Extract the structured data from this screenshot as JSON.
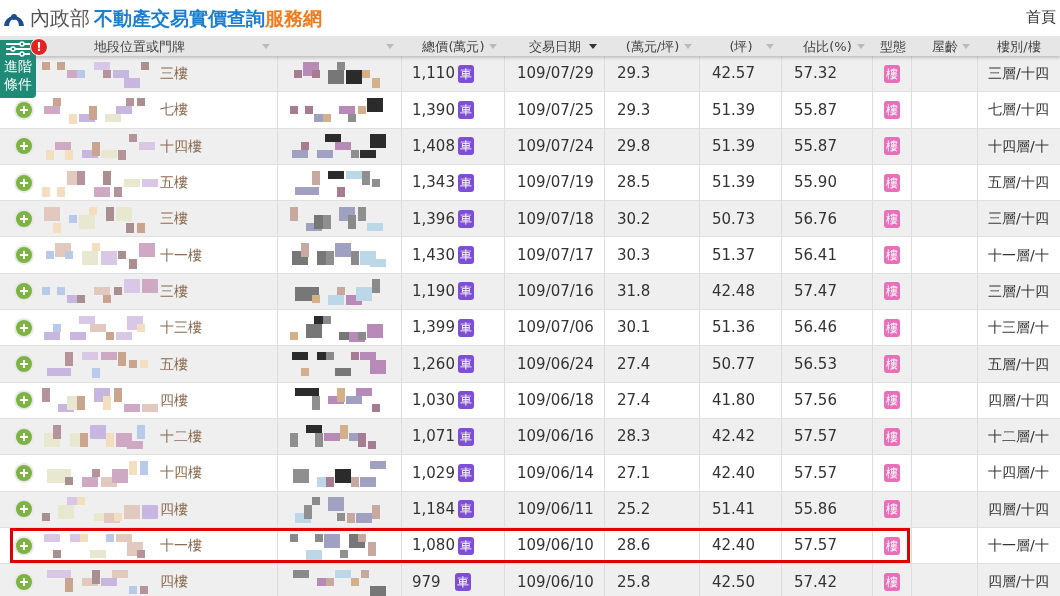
{
  "header": {
    "ministry": "內政部",
    "site_title": "不動產交易實價查詢",
    "site_suffix": "服務網",
    "nav_link": "首頁"
  },
  "filter_button": {
    "label_1": "進階",
    "label_2": "條件",
    "alert": "!"
  },
  "table": {
    "columns": [
      "地段位置或門牌",
      "",
      "總價(萬元)",
      "交易日期",
      "(萬元/坪)",
      "(坪)",
      "佔比(%)",
      "型態",
      "屋齡",
      "樓別/樓"
    ],
    "rows": [
      {
        "highlighted": false,
        "address": "三樓",
        "price": "1,110",
        "parking": "車",
        "date": "109/07/29",
        "unit_price": "29.3",
        "area": "42.57",
        "ratio": "57.32",
        "type": "樓",
        "floor": "三層/十四"
      },
      {
        "expander": true,
        "highlighted": false,
        "address": "七樓",
        "price": "1,390",
        "parking": "車",
        "date": "109/07/25",
        "unit_price": "29.3",
        "area": "51.39",
        "ratio": "55.87",
        "type": "樓",
        "floor": "七層/十四"
      },
      {
        "expander": true,
        "highlighted": false,
        "address": "十四樓",
        "price": "1,408",
        "parking": "車",
        "date": "109/07/24",
        "unit_price": "29.8",
        "area": "51.39",
        "ratio": "55.87",
        "type": "樓",
        "floor": "十四層/十"
      },
      {
        "expander": true,
        "highlighted": false,
        "address": "五樓",
        "price": "1,343",
        "parking": "車",
        "date": "109/07/19",
        "unit_price": "28.5",
        "area": "51.39",
        "ratio": "55.90",
        "type": "樓",
        "floor": "五層/十四"
      },
      {
        "expander": true,
        "highlighted": false,
        "address": "三樓",
        "price": "1,396",
        "parking": "車",
        "date": "109/07/18",
        "unit_price": "30.2",
        "area": "50.73",
        "ratio": "56.76",
        "type": "樓",
        "floor": "三層/十四"
      },
      {
        "expander": true,
        "highlighted": false,
        "address": "十一樓",
        "price": "1,430",
        "parking": "車",
        "date": "109/07/17",
        "unit_price": "30.3",
        "area": "51.37",
        "ratio": "56.41",
        "type": "樓",
        "floor": "十一層/十"
      },
      {
        "expander": true,
        "highlighted": false,
        "address": "三樓",
        "price": "1,190",
        "parking": "車",
        "date": "109/07/16",
        "unit_price": "31.8",
        "area": "42.48",
        "ratio": "57.47",
        "type": "樓",
        "floor": "三層/十四"
      },
      {
        "expander": true,
        "highlighted": false,
        "address": "十三樓",
        "price": "1,399",
        "parking": "車",
        "date": "109/07/06",
        "unit_price": "30.1",
        "area": "51.36",
        "ratio": "56.46",
        "type": "樓",
        "floor": "十三層/十"
      },
      {
        "expander": true,
        "highlighted": false,
        "address": "五樓",
        "price": "1,260",
        "parking": "車",
        "date": "109/06/24",
        "unit_price": "27.4",
        "area": "50.77",
        "ratio": "56.53",
        "type": "樓",
        "floor": "五層/十四"
      },
      {
        "expander": true,
        "highlighted": false,
        "address": "四樓",
        "price": "1,030",
        "parking": "車",
        "date": "109/06/18",
        "unit_price": "27.4",
        "area": "41.80",
        "ratio": "57.56",
        "type": "樓",
        "floor": "四層/十四"
      },
      {
        "expander": true,
        "highlighted": false,
        "address": "十二樓",
        "price": "1,071",
        "parking": "車",
        "date": "109/06/16",
        "unit_price": "28.3",
        "area": "42.42",
        "ratio": "57.57",
        "type": "樓",
        "floor": "十二層/十"
      },
      {
        "expander": true,
        "highlighted": false,
        "address": "十四樓",
        "price": "1,029",
        "parking": "車",
        "date": "109/06/14",
        "unit_price": "27.1",
        "area": "42.40",
        "ratio": "57.57",
        "type": "樓",
        "floor": "十四層/十"
      },
      {
        "expander": true,
        "highlighted": false,
        "address": "四樓",
        "price": "1,184",
        "parking": "車",
        "date": "109/06/11",
        "unit_price": "25.2",
        "area": "51.41",
        "ratio": "55.86",
        "type": "樓",
        "floor": "四層/十四"
      },
      {
        "expander": true,
        "highlighted": true,
        "address": "十一樓",
        "price": "1,080",
        "parking": "車",
        "date": "109/06/10",
        "unit_price": "28.6",
        "area": "42.40",
        "ratio": "57.57",
        "type": "樓",
        "floor": "十一層/十"
      },
      {
        "expander": true,
        "highlighted": false,
        "address": "四樓",
        "price": "979",
        "parking": "車",
        "date": "109/06/10",
        "unit_price": "25.8",
        "area": "42.50",
        "ratio": "57.42",
        "type": "樓",
        "floor": "四層/十四"
      }
    ]
  }
}
